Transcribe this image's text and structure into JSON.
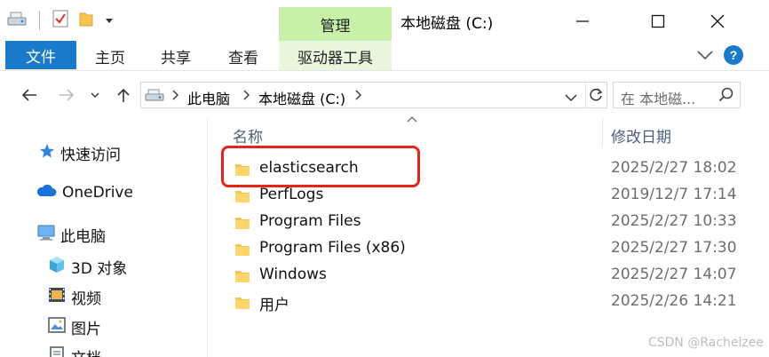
{
  "titlebar": {
    "manage_tab": "管理",
    "window_title": "本地磁盘 (C:)",
    "quick_access_icons": [
      "drive-icon",
      "properties-check-icon",
      "new-folder-icon",
      "dropdown-arrow-icon"
    ]
  },
  "ribbon": {
    "tabs": [
      {
        "label": "文件"
      },
      {
        "label": "主页"
      },
      {
        "label": "共享"
      },
      {
        "label": "查看"
      },
      {
        "label": "驱动器工具"
      }
    ]
  },
  "address": {
    "breadcrumb": [
      "此电脑",
      "本地磁盘 (C:)"
    ],
    "search_placeholder": "在 本地磁..."
  },
  "nav_pane": {
    "items": [
      {
        "label": "快速访问",
        "icon": "star-icon"
      },
      {
        "label": "OneDrive",
        "icon": "cloud-icon"
      },
      {
        "label": "此电脑",
        "icon": "computer-icon"
      },
      {
        "label": "3D 对象",
        "icon": "cube-icon"
      },
      {
        "label": "视频",
        "icon": "film-icon"
      },
      {
        "label": "图片",
        "icon": "picture-icon"
      },
      {
        "label": "文档",
        "icon": "document-icon"
      }
    ]
  },
  "file_list": {
    "columns": {
      "name": "名称",
      "modified": "修改日期"
    },
    "rows": [
      {
        "name": "elasticsearch",
        "modified": "2025/2/27 18:02",
        "highlighted": true
      },
      {
        "name": "PerfLogs",
        "modified": "2019/12/7 17:14"
      },
      {
        "name": "Program Files",
        "modified": "2025/2/27 10:33"
      },
      {
        "name": "Program Files (x86)",
        "modified": "2025/2/27 17:30"
      },
      {
        "name": "Windows",
        "modified": "2025/2/27 14:07"
      },
      {
        "name": "用户",
        "modified": "2025/2/26 14:21"
      }
    ]
  },
  "colors": {
    "accent_blue": "#1979ca",
    "manage_green": "#c8f0a8",
    "highlight_red": "#e8231a",
    "folder_yellow": "#f5c451"
  },
  "watermark": "CSDN @Rachelzee"
}
